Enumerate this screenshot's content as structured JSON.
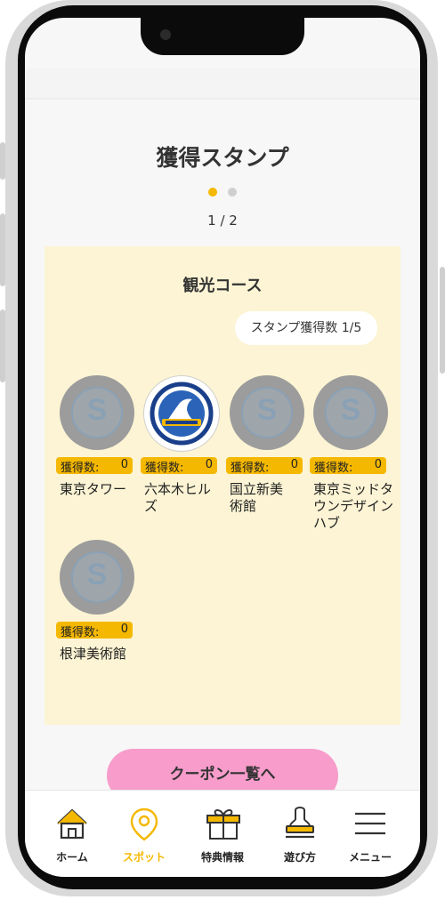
{
  "page": {
    "title": "獲得スタンプ",
    "pager": "1 / 2"
  },
  "course": {
    "title": "観光コース",
    "stamp_count": "スタンプ獲得数 1/5",
    "badge_label": "獲得数:",
    "spots": [
      {
        "name": "東京タワー",
        "count": "0",
        "stamp": "empty",
        "letter": "S"
      },
      {
        "name": "六本木ヒルズ",
        "count": "0",
        "stamp": "acquired"
      },
      {
        "name": "国立新美術館",
        "count": "0",
        "stamp": "empty",
        "letter": "S"
      },
      {
        "name": "東京ミッドタウンデザインハブ",
        "count": "0",
        "stamp": "empty",
        "letter": "S"
      },
      {
        "name": "根津美術館",
        "count": "0",
        "stamp": "empty",
        "letter": "S"
      }
    ]
  },
  "coupon_button": "クーポン一覧へ",
  "tabs": [
    {
      "label": "ホーム",
      "icon": "home-icon"
    },
    {
      "label": "スポット",
      "icon": "map-pin-icon",
      "active": true
    },
    {
      "label": "特典情報",
      "icon": "gift-icon"
    },
    {
      "label": "遊び方",
      "icon": "stamp-icon"
    },
    {
      "label": "メニュー",
      "icon": "menu-icon"
    }
  ],
  "colors": {
    "accent": "#f5b800",
    "course_bg": "#fcf4d4",
    "coupon_button": "#f79ccb"
  }
}
